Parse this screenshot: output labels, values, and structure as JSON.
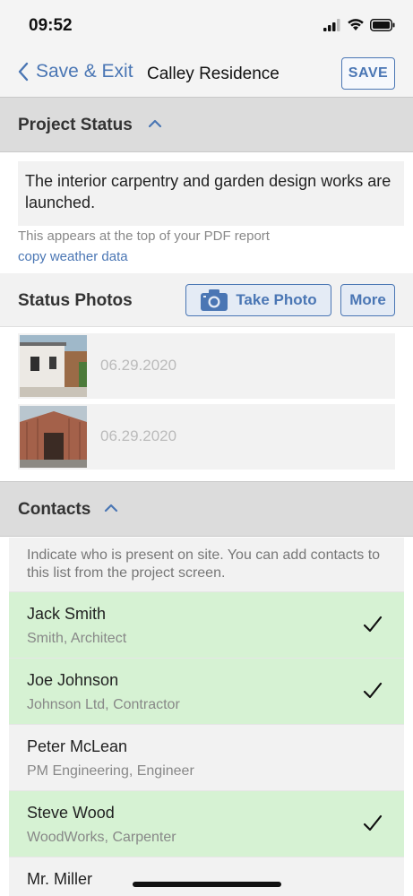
{
  "status_bar": {
    "time": "09:52"
  },
  "nav": {
    "back_label": "Save & Exit",
    "title": "Calley Residence",
    "save_label": "SAVE"
  },
  "project_status": {
    "header": "Project Status",
    "text": "The interior carpentry and garden design works are launched.",
    "hint": "This appears at the top of your PDF report",
    "weather_link": "copy weather data"
  },
  "status_photos": {
    "header": "Status Photos",
    "take_photo_label": "Take Photo",
    "more_label": "More",
    "photos": [
      {
        "date": "06.29.2020"
      },
      {
        "date": "06.29.2020"
      }
    ]
  },
  "contacts": {
    "header": "Contacts",
    "hint": "Indicate who is present on site. You can add contacts to this list from the project screen.",
    "items": [
      {
        "name": "Jack Smith",
        "subtitle": "Smith, Architect",
        "present": true
      },
      {
        "name": "Joe Johnson",
        "subtitle": "Johnson Ltd, Contractor",
        "present": true
      },
      {
        "name": "Peter McLean",
        "subtitle": "PM Engineering, Engineer",
        "present": false
      },
      {
        "name": "Steve Wood",
        "subtitle": "WoodWorks, Carpenter",
        "present": true
      },
      {
        "name": "Mr. Miller",
        "subtitle": "",
        "present": false
      }
    ]
  },
  "colors": {
    "accent": "#4a76b4",
    "selected_row": "#d6f2d3",
    "section_header": "#dcdcdc"
  }
}
